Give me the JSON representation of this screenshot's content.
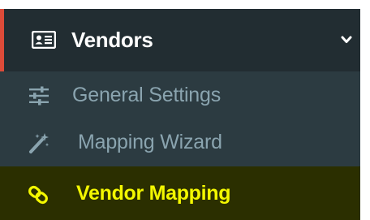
{
  "menu": {
    "header": {
      "label": "Vendors",
      "icon": "id-card-icon",
      "expand_icon": "chevron-down-icon"
    },
    "items": [
      {
        "label": "General Settings",
        "icon": "sliders-icon",
        "active": false
      },
      {
        "label": "Mapping Wizard",
        "icon": "magic-wand-icon",
        "active": false
      },
      {
        "label": "Vendor Mapping",
        "icon": "link-icon",
        "active": true
      }
    ]
  },
  "colors": {
    "header_bg": "#222d32",
    "header_accent": "#dd4b39",
    "submenu_bg": "#2c3b41",
    "submenu_text": "#8aa4af",
    "active_bg": "#2b2f00",
    "active_text": "#f3f700"
  }
}
